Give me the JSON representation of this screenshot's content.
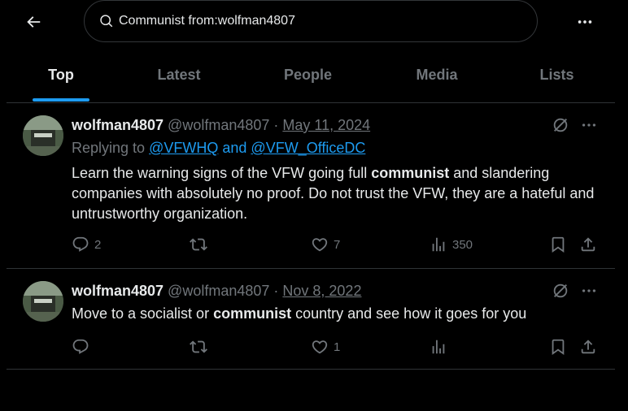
{
  "search": {
    "query": "Communist from:wolfman4807"
  },
  "tabs": [
    {
      "label": "Top"
    },
    {
      "label": "Latest"
    },
    {
      "label": "People"
    },
    {
      "label": "Media"
    },
    {
      "label": "Lists"
    }
  ],
  "tweets": [
    {
      "name": "wolfman4807",
      "handle": "@wolfman4807",
      "dot": "·",
      "date": "May 11, 2024",
      "replying_prefix": "Replying to",
      "mention1": "@VFWHQ",
      "and": "and",
      "mention2": "@VFW_OfficeDC",
      "text_before": "Learn the warning signs of the VFW going full ",
      "text_bold": "communist",
      "text_after": " and slandering companies with absolutely no proof. Do not trust the VFW, they are a hateful and untrustworthy organization.",
      "replies": "2",
      "reposts": "",
      "likes": "7",
      "views": "350"
    },
    {
      "name": "wolfman4807",
      "handle": "@wolfman4807",
      "dot": "·",
      "date": "Nov 8, 2022",
      "text_before": "Move to a socialist or ",
      "text_bold": "communist",
      "text_after": " country and see how it goes for you",
      "replies": "",
      "reposts": "",
      "likes": "1",
      "views": ""
    }
  ],
  "colors": {
    "accent": "#1d9bf0",
    "background": "#000000",
    "text": "#e7e9ea",
    "muted": "#71767b",
    "border": "#2f3336"
  }
}
